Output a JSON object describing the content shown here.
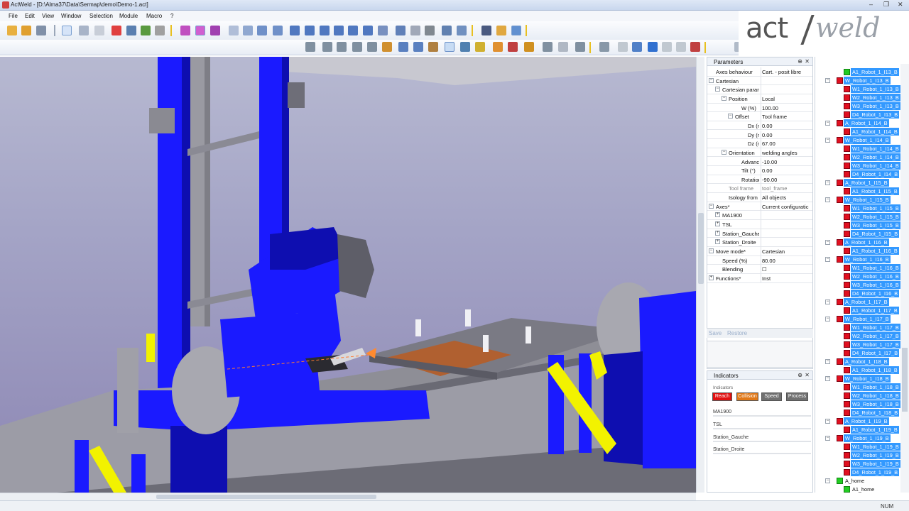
{
  "window": {
    "title": "ActWeld - [D:\\Alma37\\Data\\Sermap\\demo\\Demo-1.act]",
    "min_glyph": "–",
    "max_glyph": "❐",
    "close_glyph": "✕"
  },
  "menu": [
    "File",
    "Edit",
    "View",
    "Window",
    "Selection",
    "Module",
    "Macro",
    "?"
  ],
  "logo": {
    "part1": "act",
    "part2": "weld"
  },
  "parameters": {
    "title": "Parameters",
    "pin_glyph": "⊕",
    "close_glyph": "✕",
    "rows": [
      {
        "label": "Axes behaviour",
        "value": "Cart. - posit libre",
        "indent": 0,
        "toggle": ""
      },
      {
        "label": "Cartesian",
        "value": "",
        "indent": 0,
        "toggle": "−"
      },
      {
        "label": "Cartesian parar",
        "value": "",
        "indent": 1,
        "toggle": "−"
      },
      {
        "label": "Position",
        "value": "Local",
        "indent": 2,
        "toggle": "−"
      },
      {
        "label": "W (%)",
        "value": "100.00",
        "indent": 4,
        "toggle": ""
      },
      {
        "label": "Offset",
        "value": "Tool frame",
        "indent": 3,
        "toggle": "−"
      },
      {
        "label": "Dx (mm",
        "value": "0.00",
        "indent": 5,
        "toggle": ""
      },
      {
        "label": "Dy (mm",
        "value": "0.00",
        "indent": 5,
        "toggle": ""
      },
      {
        "label": "Dz (mm",
        "value": "67.00",
        "indent": 5,
        "toggle": ""
      },
      {
        "label": "Orientation",
        "value": "welding angles",
        "indent": 2,
        "toggle": "−"
      },
      {
        "label": "Advance (",
        "value": "-10.00",
        "indent": 4,
        "toggle": ""
      },
      {
        "label": "Tilt (°)",
        "value": "0.00",
        "indent": 4,
        "toggle": ""
      },
      {
        "label": "Rotation (",
        "value": "-90.00",
        "indent": 4,
        "toggle": ""
      },
      {
        "label": "Tool frame",
        "value": "tool_frame",
        "indent": 2,
        "toggle": "",
        "gray": true
      },
      {
        "label": "Isology from",
        "value": "All objects",
        "indent": 2,
        "toggle": ""
      },
      {
        "label": "Axes*",
        "value": "Current configuratic",
        "indent": 0,
        "toggle": "−"
      },
      {
        "label": "MA1900",
        "value": "",
        "indent": 1,
        "toggle": "+"
      },
      {
        "label": "TSL",
        "value": "",
        "indent": 1,
        "toggle": "+"
      },
      {
        "label": "Station_Gauche",
        "value": "",
        "indent": 1,
        "toggle": "+"
      },
      {
        "label": "Station_Droite",
        "value": "",
        "indent": 1,
        "toggle": "+"
      },
      {
        "label": "Move mode*",
        "value": "Cartesian",
        "indent": 0,
        "toggle": "−"
      },
      {
        "label": "Speed (%)",
        "value": "80.00",
        "indent": 1,
        "toggle": ""
      },
      {
        "label": "Blending",
        "value": "☐",
        "indent": 1,
        "toggle": ""
      },
      {
        "label": "Functions*",
        "value": "Inst",
        "indent": 0,
        "toggle": "+"
      }
    ],
    "save_label": "Save",
    "restore_label": "Restore"
  },
  "indicators": {
    "title": "Indicators",
    "pin_glyph": "⊕",
    "close_glyph": "✕",
    "group_label": "Indicators",
    "buttons": [
      {
        "label": "Reach",
        "color": "#e01010"
      },
      {
        "label": "Collision",
        "color": "#e07818"
      },
      {
        "label": "Speed",
        "color": "#707070"
      },
      {
        "label": "Process",
        "color": "#707070"
      }
    ],
    "rows": [
      "MA1900",
      "TSL",
      "Station_Gauche",
      "Station_Droite"
    ]
  },
  "tree": {
    "nodes": [
      {
        "label": "A1_Robot_1_I13_B",
        "level": 3,
        "icon": "green",
        "sel": true,
        "exp": ""
      },
      {
        "label": "W_Robot_1_I13_B",
        "level": 2,
        "icon": "red",
        "sel": true,
        "exp": "−"
      },
      {
        "label": "W1_Robot_1_I13_B",
        "level": 3,
        "icon": "red",
        "sel": true,
        "exp": ""
      },
      {
        "label": "W2_Robot_1_I13_B",
        "level": 3,
        "icon": "red",
        "sel": true,
        "exp": ""
      },
      {
        "label": "W3_Robot_1_I13_B",
        "level": 3,
        "icon": "red",
        "sel": true,
        "exp": ""
      },
      {
        "label": "D4_Robot_1_I13_B",
        "level": 3,
        "icon": "red",
        "sel": true,
        "exp": ""
      },
      {
        "label": "A_Robot_1_I14_B",
        "level": 2,
        "icon": "red",
        "sel": true,
        "exp": "−"
      },
      {
        "label": "A1_Robot_1_I14_B",
        "level": 3,
        "icon": "red",
        "sel": true,
        "exp": ""
      },
      {
        "label": "W_Robot_1_I14_B",
        "level": 2,
        "icon": "red",
        "sel": true,
        "exp": "−"
      },
      {
        "label": "W1_Robot_1_I14_B",
        "level": 3,
        "icon": "red",
        "sel": true,
        "exp": ""
      },
      {
        "label": "W2_Robot_1_I14_B",
        "level": 3,
        "icon": "red",
        "sel": true,
        "exp": ""
      },
      {
        "label": "W3_Robot_1_I14_B",
        "level": 3,
        "icon": "red",
        "sel": true,
        "exp": ""
      },
      {
        "label": "D4_Robot_1_I14_B",
        "level": 3,
        "icon": "red",
        "sel": true,
        "exp": ""
      },
      {
        "label": "A_Robot_1_I15_B",
        "level": 2,
        "icon": "red",
        "sel": true,
        "exp": "−"
      },
      {
        "label": "A1_Robot_1_I15_B",
        "level": 3,
        "icon": "red",
        "sel": true,
        "exp": ""
      },
      {
        "label": "W_Robot_1_I15_B",
        "level": 2,
        "icon": "red",
        "sel": true,
        "exp": "−"
      },
      {
        "label": "W1_Robot_1_I15_B",
        "level": 3,
        "icon": "red",
        "sel": true,
        "exp": ""
      },
      {
        "label": "W2_Robot_1_I15_B",
        "level": 3,
        "icon": "red",
        "sel": true,
        "exp": ""
      },
      {
        "label": "W3_Robot_1_I15_B",
        "level": 3,
        "icon": "red",
        "sel": true,
        "exp": ""
      },
      {
        "label": "D4_Robot_1_I15_B",
        "level": 3,
        "icon": "red",
        "sel": true,
        "exp": ""
      },
      {
        "label": "A_Robot_1_I16_B",
        "level": 2,
        "icon": "red",
        "sel": true,
        "exp": "−"
      },
      {
        "label": "A1_Robot_1_I16_B",
        "level": 3,
        "icon": "red",
        "sel": true,
        "exp": ""
      },
      {
        "label": "W_Robot_1_I16_B",
        "level": 2,
        "icon": "red",
        "sel": true,
        "exp": "−"
      },
      {
        "label": "W1_Robot_1_I16_B",
        "level": 3,
        "icon": "red",
        "sel": true,
        "exp": ""
      },
      {
        "label": "W2_Robot_1_I16_B",
        "level": 3,
        "icon": "red",
        "sel": true,
        "exp": ""
      },
      {
        "label": "W3_Robot_1_I16_B",
        "level": 3,
        "icon": "red",
        "sel": true,
        "exp": ""
      },
      {
        "label": "D4_Robot_1_I16_B",
        "level": 3,
        "icon": "red",
        "sel": true,
        "exp": ""
      },
      {
        "label": "A_Robot_1_I17_B",
        "level": 2,
        "icon": "red",
        "sel": true,
        "exp": "−"
      },
      {
        "label": "A1_Robot_1_I17_B",
        "level": 3,
        "icon": "red",
        "sel": true,
        "exp": ""
      },
      {
        "label": "W_Robot_1_I17_B",
        "level": 2,
        "icon": "red",
        "sel": true,
        "exp": "−"
      },
      {
        "label": "W1_Robot_1_I17_B",
        "level": 3,
        "icon": "red",
        "sel": true,
        "exp": ""
      },
      {
        "label": "W2_Robot_1_I17_B",
        "level": 3,
        "icon": "red",
        "sel": true,
        "exp": ""
      },
      {
        "label": "W3_Robot_1_I17_B",
        "level": 3,
        "icon": "red",
        "sel": true,
        "exp": ""
      },
      {
        "label": "D4_Robot_1_I17_B",
        "level": 3,
        "icon": "red",
        "sel": true,
        "exp": ""
      },
      {
        "label": "A_Robot_1_I18_B",
        "level": 2,
        "icon": "red",
        "sel": true,
        "exp": "−"
      },
      {
        "label": "A1_Robot_1_I18_B",
        "level": 3,
        "icon": "red",
        "sel": true,
        "exp": ""
      },
      {
        "label": "W_Robot_1_I18_B",
        "level": 2,
        "icon": "red",
        "sel": true,
        "exp": "−"
      },
      {
        "label": "W1_Robot_1_I18_B",
        "level": 3,
        "icon": "red",
        "sel": true,
        "exp": ""
      },
      {
        "label": "W2_Robot_1_I18_B",
        "level": 3,
        "icon": "red",
        "sel": true,
        "exp": ""
      },
      {
        "label": "W3_Robot_1_I18_B",
        "level": 3,
        "icon": "red",
        "sel": true,
        "exp": ""
      },
      {
        "label": "D4_Robot_1_I18_B",
        "level": 3,
        "icon": "red",
        "sel": true,
        "exp": ""
      },
      {
        "label": "A_Robot_1_I19_B",
        "level": 2,
        "icon": "red",
        "sel": true,
        "exp": "−"
      },
      {
        "label": "A1_Robot_1_I19_B",
        "level": 3,
        "icon": "red",
        "sel": true,
        "exp": ""
      },
      {
        "label": "W_Robot_1_I19_B",
        "level": 2,
        "icon": "red",
        "sel": true,
        "exp": "−"
      },
      {
        "label": "W1_Robot_1_I19_B",
        "level": 3,
        "icon": "red",
        "sel": true,
        "exp": ""
      },
      {
        "label": "W2_Robot_1_I19_B",
        "level": 3,
        "icon": "red",
        "sel": true,
        "exp": ""
      },
      {
        "label": "W3_Robot_1_I19_B",
        "level": 3,
        "icon": "red",
        "sel": true,
        "exp": ""
      },
      {
        "label": "D4_Robot_1_I19_B",
        "level": 3,
        "icon": "red",
        "sel": true,
        "exp": ""
      },
      {
        "label": "A_home",
        "level": 2,
        "icon": "green",
        "sel": false,
        "exp": "−"
      },
      {
        "label": "A1_home",
        "level": 3,
        "icon": "green",
        "sel": false,
        "exp": ""
      }
    ]
  },
  "status": {
    "num": "NUM"
  },
  "colors": {
    "accent_selection": "#3399ff",
    "robot_blue": "#1a1aff",
    "safety_yellow": "#f2f200"
  }
}
